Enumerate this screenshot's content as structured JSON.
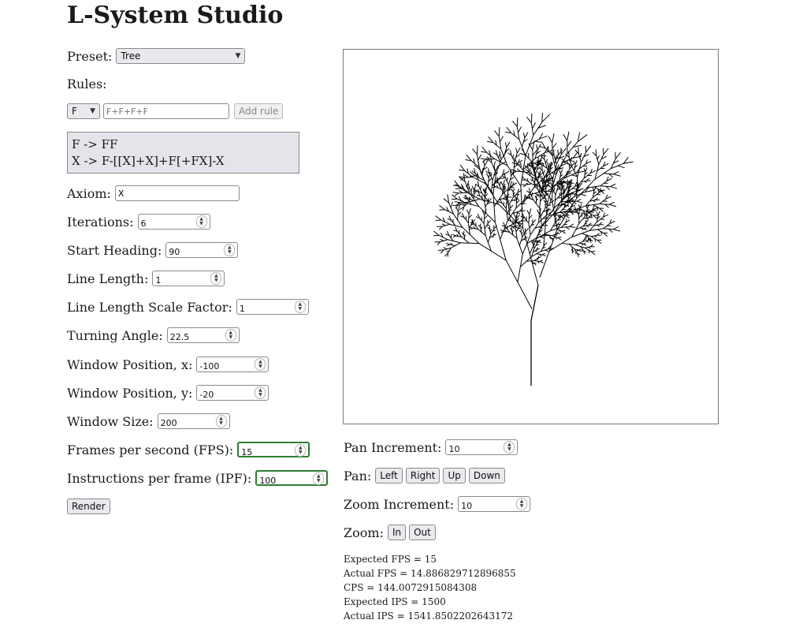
{
  "app": {
    "title": "L-System Studio"
  },
  "preset": {
    "label": "Preset:",
    "value": "Tree"
  },
  "rules": {
    "label": "Rules:",
    "symbol": "F",
    "placeholder": "F+F+F+F",
    "add_label": "Add rule",
    "list": [
      "F -> FF",
      "X -> F-[[X]+X]+F[+FX]-X"
    ]
  },
  "axiom": {
    "label": "Axiom:",
    "value": "X"
  },
  "fields": {
    "iterations": {
      "label": "Iterations:",
      "value": "6"
    },
    "start_heading": {
      "label": "Start Heading:",
      "value": "90"
    },
    "line_length": {
      "label": "Line Length:",
      "value": "1"
    },
    "scale_factor": {
      "label": "Line Length Scale Factor:",
      "value": "1"
    },
    "turning_angle": {
      "label": "Turning Angle:",
      "value": "22.5"
    },
    "window_x": {
      "label": "Window Position, x:",
      "value": "-100"
    },
    "window_y": {
      "label": "Window Position, y:",
      "value": "-20"
    },
    "window_size": {
      "label": "Window Size:",
      "value": "200"
    },
    "fps": {
      "label": "Frames per second (FPS):",
      "value": "15"
    },
    "ipf": {
      "label": "Instructions per frame (IPF):",
      "value": "100"
    }
  },
  "render_label": "Render",
  "pan": {
    "increment_label": "Pan Increment:",
    "increment_value": "10",
    "label": "Pan:",
    "left": "Left",
    "right": "Right",
    "up": "Up",
    "down": "Down"
  },
  "zoom": {
    "increment_label": "Zoom Increment:",
    "increment_value": "10",
    "label": "Zoom:",
    "in": "In",
    "out": "Out"
  },
  "stats": [
    "Expected FPS = 15",
    "Actual FPS = 14.886829712896855",
    "CPS = 144.0072915084308",
    "Expected IPS = 1500",
    "Actual IPS = 1541.8502202643172"
  ],
  "colors": {
    "focus_border": "#2e7d32",
    "rules_bg": "#e4e4ea",
    "plant_stroke": "#000000"
  }
}
